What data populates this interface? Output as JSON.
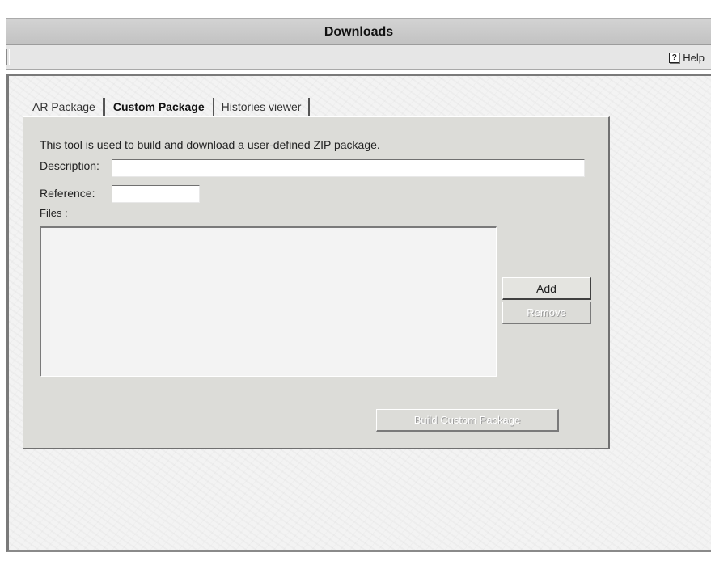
{
  "window": {
    "title": "Downloads"
  },
  "toolbar": {
    "help_label": "Help",
    "help_icon": "help-icon"
  },
  "tabs": [
    {
      "label": "AR Package",
      "active": false
    },
    {
      "label": "Custom Package",
      "active": true
    },
    {
      "label": "Histories viewer",
      "active": false
    }
  ],
  "custom_package": {
    "intro": "This tool is used to build and download a user-defined ZIP package.",
    "description_label": "Description:",
    "description_value": "",
    "reference_label": "Reference:",
    "reference_value": "",
    "files_label": "Files :",
    "files": [],
    "add_label": "Add",
    "remove_label": "Remove",
    "remove_enabled": false,
    "build_label": "Build Custom Package",
    "build_enabled": false
  }
}
